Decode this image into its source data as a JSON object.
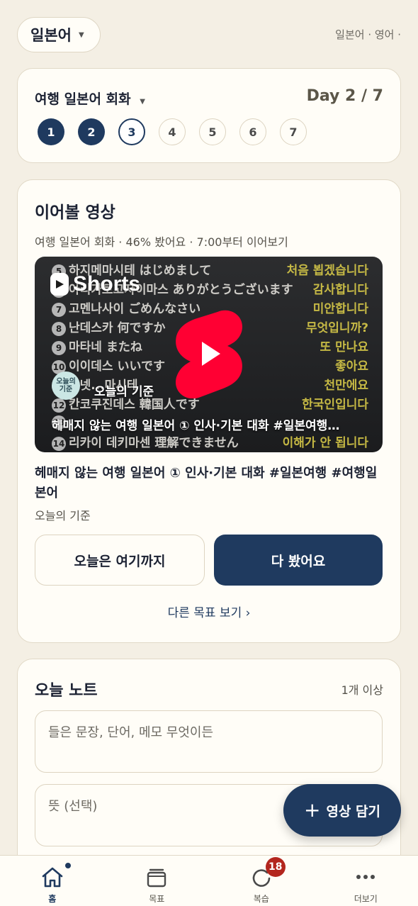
{
  "header": {
    "language": "일본어",
    "language_list": "일본어 · 영어 ·"
  },
  "plan": {
    "title": "여행 일본어 회화",
    "day_label": "Day 2 / 7",
    "days": [
      {
        "label": "1",
        "state": "done"
      },
      {
        "label": "2",
        "state": "done"
      },
      {
        "label": "3",
        "state": "current"
      },
      {
        "label": "4",
        "state": "todo"
      },
      {
        "label": "5",
        "state": "todo"
      },
      {
        "label": "6",
        "state": "todo"
      },
      {
        "label": "7",
        "state": "todo"
      }
    ]
  },
  "continue": {
    "title": "이어볼 영상",
    "meta": "여행 일본어 회화 · 46% 봤어요 · 7:00부터 이어보기",
    "thumbnail": {
      "platform_label": "Shorts",
      "channel_badge": "오늘의 기준",
      "channel_name": "오늘의 기준",
      "caption": "헤매지 않는 여행 일본어 ① 인사·기본 대화 #일본여행…",
      "rows": [
        {
          "num": "5",
          "jp": "하지메마시테 はじめまして",
          "ko": "처음 뵙겠습니다"
        },
        {
          "num": "6",
          "jp": "아리가토고자이마스 ありがとうございます",
          "ko": "감사합니다"
        },
        {
          "num": "7",
          "jp": "고멘나사이 ごめんなさい",
          "ko": "미안합니다"
        },
        {
          "num": "8",
          "jp": "난데스카 何ですか",
          "ko": "무엇입니까?"
        },
        {
          "num": "9",
          "jp": "마타네 またね",
          "ko": "또 만나요"
        },
        {
          "num": "10",
          "jp": "이이데스 いいです",
          "ko": "좋아요"
        },
        {
          "num": "11",
          "jp": "오넷...마시테",
          "ko": "천만에요"
        },
        {
          "num": "12",
          "jp": "칸코쿠진데스 韓国人です",
          "ko": "한국인입니다"
        },
        {
          "num": "13",
          "jp": "",
          "ko": ""
        },
        {
          "num": "14",
          "jp": "리카이 데키마센 理解できません",
          "ko": "이해가 안 됩니다"
        }
      ]
    },
    "video_title": "헤매지 않는 여행 일본어 ① 인사·기본 대화 #일본여행 #여행일본어",
    "video_channel": "오늘의 기준",
    "stop_button": "오늘은 여기까지",
    "done_button": "다 봤어요",
    "other_goals_link": "다른 목표 보기 ›"
  },
  "note": {
    "title": "오늘 노트",
    "count_hint": "1개 이상",
    "main_placeholder": "들은 문장, 단어, 메모 무엇이든",
    "meaning_placeholder": "뜻 (선택)"
  },
  "fab": {
    "label": "영상 담기"
  },
  "nav": {
    "items": [
      {
        "label": "홈",
        "icon": "home-icon"
      },
      {
        "label": "목표",
        "icon": "stack-icon"
      },
      {
        "label": "복습",
        "icon": "review-icon",
        "badge": "18"
      },
      {
        "label": "더보기",
        "icon": "more-icon"
      }
    ]
  },
  "colors": {
    "primary": "#1f3a5f",
    "background": "#f4efe4",
    "card": "#fffdf7",
    "badge": "#b3261e",
    "shorts_red": "#ff0033"
  }
}
